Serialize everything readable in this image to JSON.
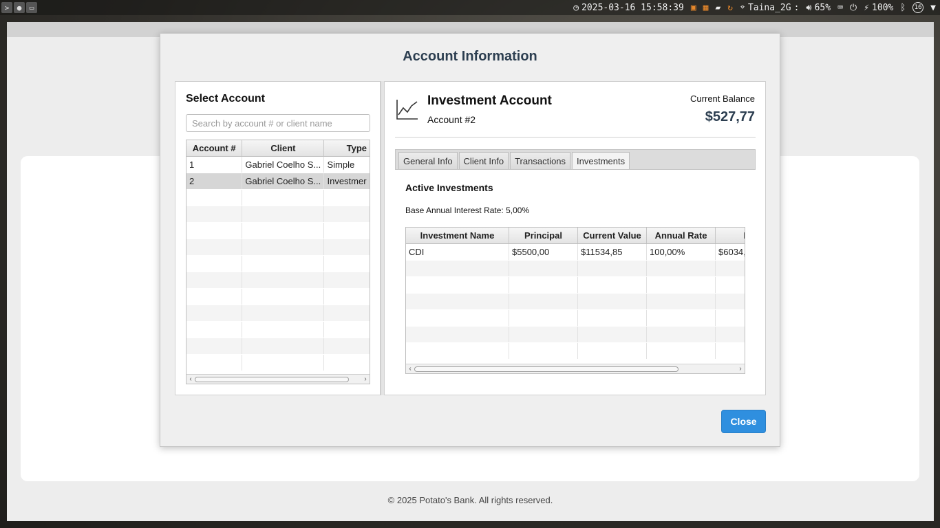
{
  "system_bar": {
    "datetime": "2025-03-16 15:58:39",
    "wifi": "Taina_2G",
    "separator": ":",
    "volume": "65%",
    "battery": "100%",
    "notif_count": "16"
  },
  "app": {
    "footer": "© 2025 Potato's Bank. All rights reserved."
  },
  "dialog": {
    "title": "Account Information",
    "select_title": "Select Account",
    "search_placeholder": "Search by account # or client name",
    "accounts_table": {
      "headers": [
        "Account #",
        "Client",
        "Type"
      ],
      "rows": [
        [
          "1",
          "Gabriel Coelho S...",
          "Simple"
        ],
        [
          "2",
          "Gabriel Coelho S...",
          "Investmer"
        ]
      ]
    },
    "account": {
      "type": "Investment Account",
      "number": "Account #2",
      "balance_label": "Current Balance",
      "balance_value": "$527,77"
    },
    "tabs": [
      "General Info",
      "Client Info",
      "Transactions",
      "Investments"
    ],
    "active_tab": "Investments",
    "investments": {
      "title": "Active Investments",
      "base_rate": "Base Annual Interest Rate: 5,00%",
      "headers": [
        "Investment Name",
        "Principal",
        "Current Value",
        "Annual Rate",
        "I"
      ],
      "rows": [
        [
          "CDI",
          "$5500,00",
          "$11534,85",
          "100,00%",
          "$6034,"
        ]
      ]
    },
    "close_label": "Close"
  }
}
